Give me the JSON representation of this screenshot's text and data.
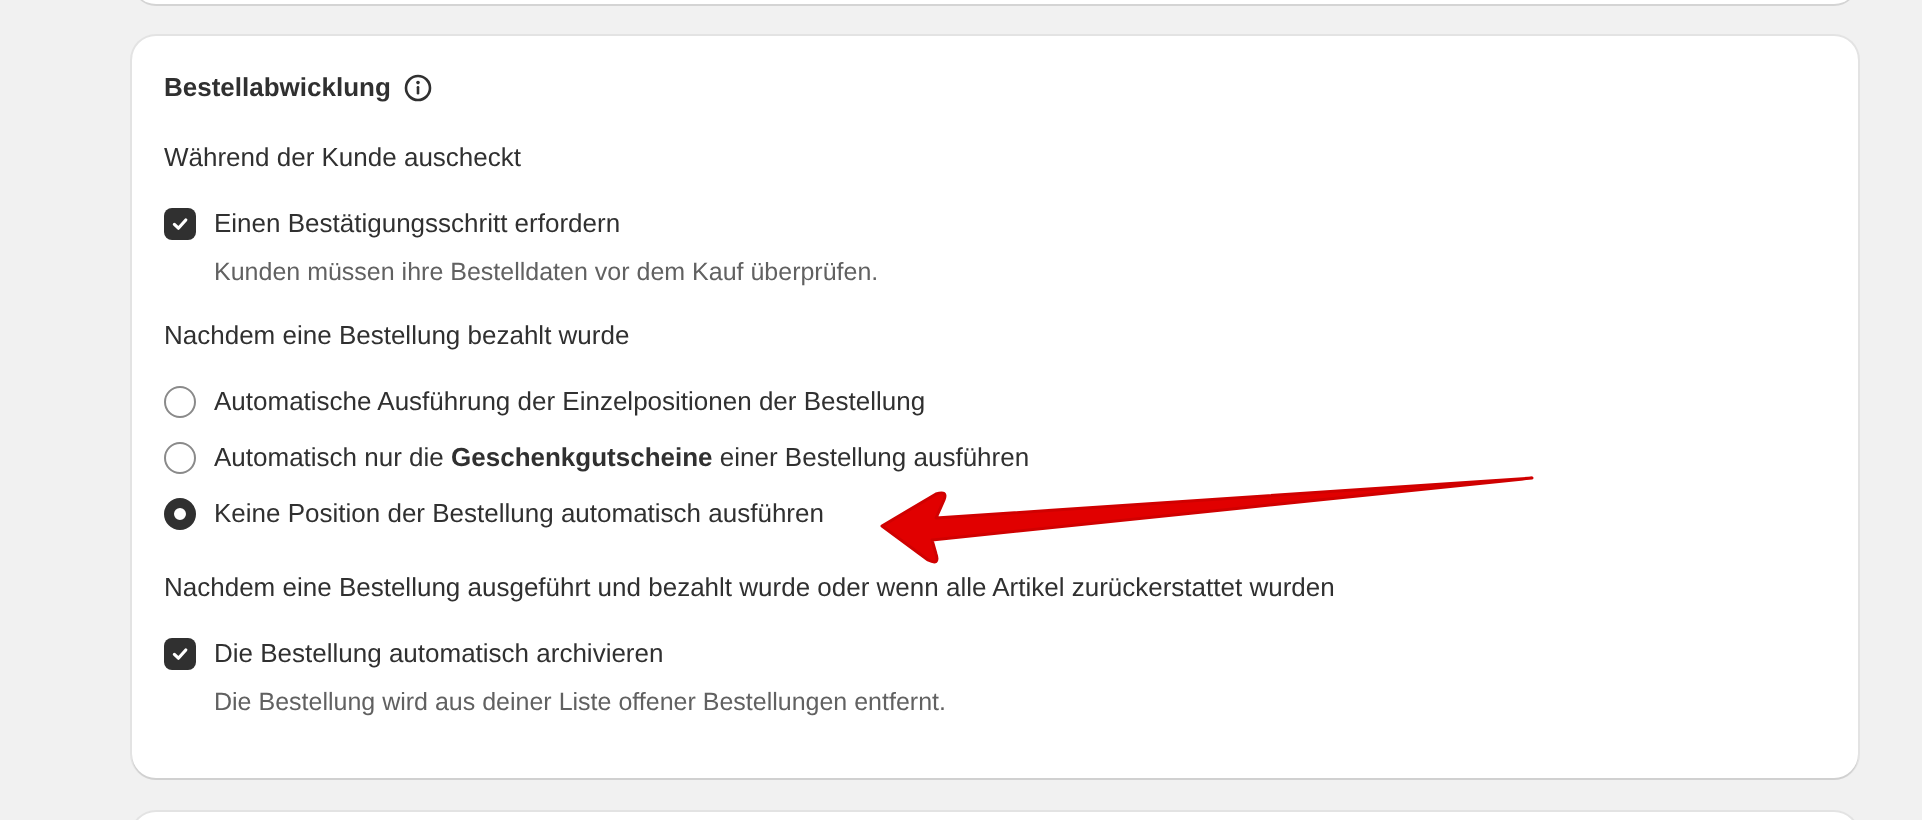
{
  "card": {
    "title": "Bestellabwicklung",
    "sections": [
      {
        "heading": "Während der Kunde auscheckt",
        "items": [
          {
            "kind": "checkbox",
            "label": "Einen Bestätigungsschritt erfordern",
            "checked": true,
            "help": "Kunden müssen ihre Bestelldaten vor dem Kauf überprüfen."
          }
        ]
      },
      {
        "heading": "Nachdem eine Bestellung bezahlt wurde",
        "items": [
          {
            "kind": "radio",
            "label": "Automatische Ausführung der Einzelpositionen der Bestellung",
            "selected": false
          },
          {
            "kind": "radio",
            "label": "Automatisch nur die **Geschenkgutscheine** einer Bestellung ausführen",
            "selected": false
          },
          {
            "kind": "radio",
            "label": "Keine Position der Bestellung automatisch ausführen",
            "selected": true
          }
        ]
      },
      {
        "heading": "Nachdem eine Bestellung ausgeführt und bezahlt wurde oder wenn alle Artikel zurückerstattet wurden",
        "items": [
          {
            "kind": "checkbox",
            "label": "Die Bestellung automatisch archivieren",
            "checked": true,
            "help": "Die Bestellung wird aus deiner Liste offener Bestellungen entfernt."
          }
        ]
      }
    ]
  },
  "annotations": [
    {
      "kind": "arrow"
    }
  ]
}
